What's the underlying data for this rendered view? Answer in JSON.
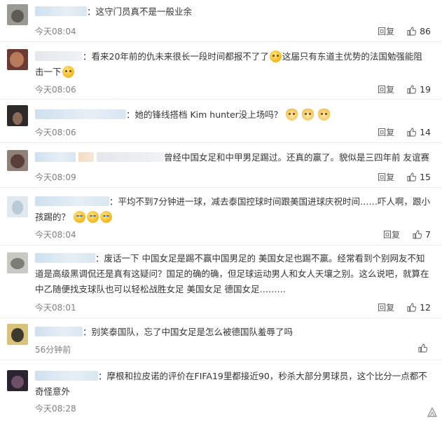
{
  "comments": [
    {
      "text": "：这守门员真不是一般业余",
      "time": "今天08:04",
      "reply": "回复",
      "likes": "86"
    },
    {
      "text_a": "：看来20年前的仇未来很长一段时间都报不了了",
      "text_b": "这届只有东道主优势的法国勉强能阻击一下",
      "time": "今天08:06",
      "reply": "回复",
      "likes": "19"
    },
    {
      "text": "：她的锋线搭档 Kim hunter没上场吗？",
      "time": "今天08:06",
      "reply": "回复",
      "likes": "14"
    },
    {
      "text": "曾经中国女足和中甲男足踢过。还真的赢了。貌似是三四年前 友谊赛",
      "time": "今天08:09",
      "reply": "回复",
      "likes": "15"
    },
    {
      "text": "：平均不到7分钟进一球，减去泰国控球时间跟美国进球庆祝时间……吓人啊，跟小孩踢的？",
      "time": "今天08:04",
      "reply": "回复",
      "likes": "7"
    },
    {
      "text": "：废话一下 中国女足是踢不赢中国男足的 美国女足也踢不赢。经常看到个别网友不知道是高级黑调侃还是真有这疑问？国足的确的确，但足球运动男人和女人天壤之别。这么说吧，就算在中乙随便找支球队也可以轻松战胜女足 美国女足 德国女足………",
      "time": "今天08:01",
      "reply": "回复",
      "likes": "12"
    },
    {
      "text": "：别笑泰国队，忘了中国女足是怎么被德国队羞辱了吗",
      "time": "56分钟前",
      "reply": "回复",
      "likes": ""
    },
    {
      "text": "：摩根和拉皮诺的评价在FIFA19里都接近90，秒杀大部分男球员，这个比分一点都不奇怪意外",
      "time": "今天08:28",
      "reply": "回复",
      "likes": ""
    }
  ],
  "icons": {
    "like": "thumbs-up-icon",
    "watermark": "logo-mark"
  },
  "colors": {
    "name_blur": "#cfe0ee",
    "time": "#808080",
    "divider": "#ededed"
  }
}
